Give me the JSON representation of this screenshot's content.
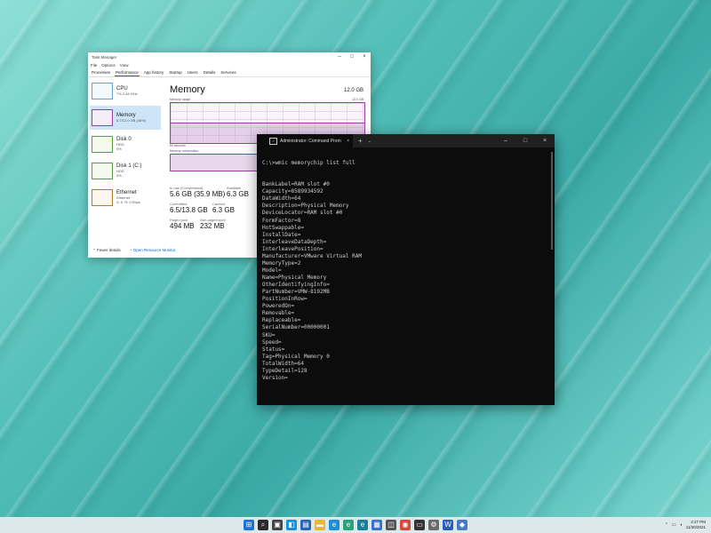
{
  "task_manager": {
    "title": "Task Manager",
    "menu": [
      "File",
      "Options",
      "View"
    ],
    "tabs": [
      "Processes",
      "Performance",
      "App history",
      "Startup",
      "Users",
      "Details",
      "Services"
    ],
    "active_tab": "Performance",
    "sidebar": [
      {
        "name": "CPU",
        "sub": "7%  2.46 GHz",
        "kind": "cpu"
      },
      {
        "name": "Memory",
        "sub": "5.7/12.0 GB (48%)",
        "kind": "mem"
      },
      {
        "name": "Disk 0",
        "sub": "HDD\n0%",
        "kind": "disk"
      },
      {
        "name": "Disk 1 (C:)",
        "sub": "HDD\n0%",
        "kind": "disk"
      },
      {
        "name": "Ethernet",
        "sub": "Ethernet\nS: 0  R: 0 Kbps",
        "kind": "eth"
      }
    ],
    "memory": {
      "title": "Memory",
      "total": "12.0 GB",
      "usage_label": "Memory usage",
      "usage_max": "12.0 GB",
      "seconds_label": "60 seconds",
      "composition_label": "Memory composition",
      "usage_fraction": 0.48,
      "stats": [
        {
          "label": "In use (Compressed)",
          "value": "5.6 GB (35.9 MB)"
        },
        {
          "label": "Available",
          "value": "6.3 GB"
        },
        {
          "label": "Committed",
          "value": "6.5/13.8 GB"
        },
        {
          "label": "Cached",
          "value": "6.3 GB"
        },
        {
          "label": "Paged pool",
          "value": "494 MB"
        },
        {
          "label": "Non-paged pool",
          "value": "232 MB"
        }
      ]
    },
    "footer": {
      "fewer": "Fewer details",
      "monitor": "Open Resource Monitor"
    }
  },
  "cmd": {
    "tab_title": "Administrator: Command Prom",
    "lines": [
      "C:\\>wmic memorychip list full",
      "",
      "",
      "BankLabel=RAM slot #0",
      "Capacity=8589934592",
      "DataWidth=64",
      "Description=Physical Memory",
      "DeviceLocator=RAM slot #0",
      "FormFactor=8",
      "HotSwappable=",
      "InstallDate=",
      "InterleaveDataDepth=",
      "InterleavePosition=",
      "Manufacturer=VMware Virtual RAM",
      "MemoryType=2",
      "Model=",
      "Name=Physical Memory",
      "OtherIdentifyingInfo=",
      "PartNumber=VMW-8192MB",
      "PositionInRow=",
      "PoweredOn=",
      "Removable=",
      "Replaceable=",
      "SerialNumber=00000001",
      "SKU=",
      "Speed=",
      "Status=",
      "Tag=Physical Memory 0",
      "TotalWidth=64",
      "TypeDetail=128",
      "Version="
    ]
  },
  "taskbar": {
    "icons": [
      {
        "name": "start-icon",
        "color": "#1f6fd6",
        "glyph": "⊞"
      },
      {
        "name": "search-icon",
        "color": "#2b2b2b",
        "glyph": "⌕"
      },
      {
        "name": "task-view-icon",
        "color": "#444444",
        "glyph": "▣"
      },
      {
        "name": "widgets-icon",
        "color": "#1a8fd6",
        "glyph": "◧"
      },
      {
        "name": "task-manager-icon",
        "color": "#2a66b8",
        "glyph": "▤"
      },
      {
        "name": "file-explorer-icon",
        "color": "#e5b83a",
        "glyph": "▬"
      },
      {
        "name": "edge-icon",
        "color": "#1c8fd8",
        "glyph": "e"
      },
      {
        "name": "edge-beta-icon",
        "color": "#2aa27a",
        "glyph": "e"
      },
      {
        "name": "edge-dev-icon",
        "color": "#1a7f9a",
        "glyph": "e"
      },
      {
        "name": "store-icon",
        "color": "#3a6fd0",
        "glyph": "▦"
      },
      {
        "name": "vm-icon",
        "color": "#555555",
        "glyph": "◫"
      },
      {
        "name": "chrome-icon",
        "color": "#d54a3a",
        "glyph": "◉"
      },
      {
        "name": "terminal-icon",
        "color": "#333333",
        "glyph": "▭"
      },
      {
        "name": "settings-icon",
        "color": "#6a6a6a",
        "glyph": "⚙"
      },
      {
        "name": "word-icon",
        "color": "#2b5fb5",
        "glyph": "W"
      },
      {
        "name": "app-icon",
        "color": "#4a7ac0",
        "glyph": "◆"
      }
    ],
    "clock_time": "2:27 PM",
    "clock_date": "11/30/2021"
  }
}
